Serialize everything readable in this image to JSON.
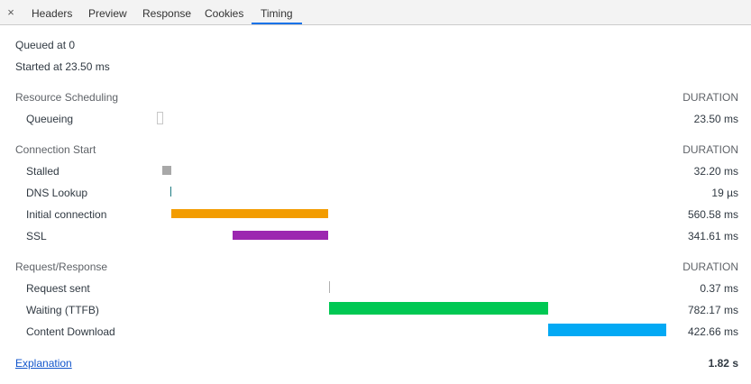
{
  "tabs": {
    "close_label": "×",
    "items": [
      "Headers",
      "Preview",
      "Response",
      "Cookies",
      "Timing"
    ],
    "active": "Timing"
  },
  "summary": {
    "queued": "Queued at 0",
    "started": "Started at 23.50 ms"
  },
  "sections": [
    {
      "title": "Resource Scheduling",
      "duration_header": "DURATION",
      "rows": [
        {
          "label": "Queueing",
          "duration": "23.50 ms"
        }
      ]
    },
    {
      "title": "Connection Start",
      "duration_header": "DURATION",
      "rows": [
        {
          "label": "Stalled",
          "duration": "32.20 ms"
        },
        {
          "label": "DNS Lookup",
          "duration": "19 µs"
        },
        {
          "label": "Initial connection",
          "duration": "560.58 ms"
        },
        {
          "label": "SSL",
          "duration": "341.61 ms"
        }
      ]
    },
    {
      "title": "Request/Response",
      "duration_header": "DURATION",
      "rows": [
        {
          "label": "Request sent",
          "duration": "0.37 ms"
        },
        {
          "label": "Waiting (TTFB)",
          "duration": "782.17 ms"
        },
        {
          "label": "Content Download",
          "duration": "422.66 ms"
        }
      ]
    }
  ],
  "footer": {
    "explanation_link": "Explanation",
    "total": "1.82 s"
  },
  "colors": {
    "queueing": "#ffffff",
    "stalled": "#a8a8a8",
    "dns": "#1f7c83",
    "initial_connection": "#f39c00",
    "ssl": "#9c27b0",
    "request_sent": "#b0b0b0",
    "waiting": "#00c853",
    "content_download": "#03a9f4"
  }
}
